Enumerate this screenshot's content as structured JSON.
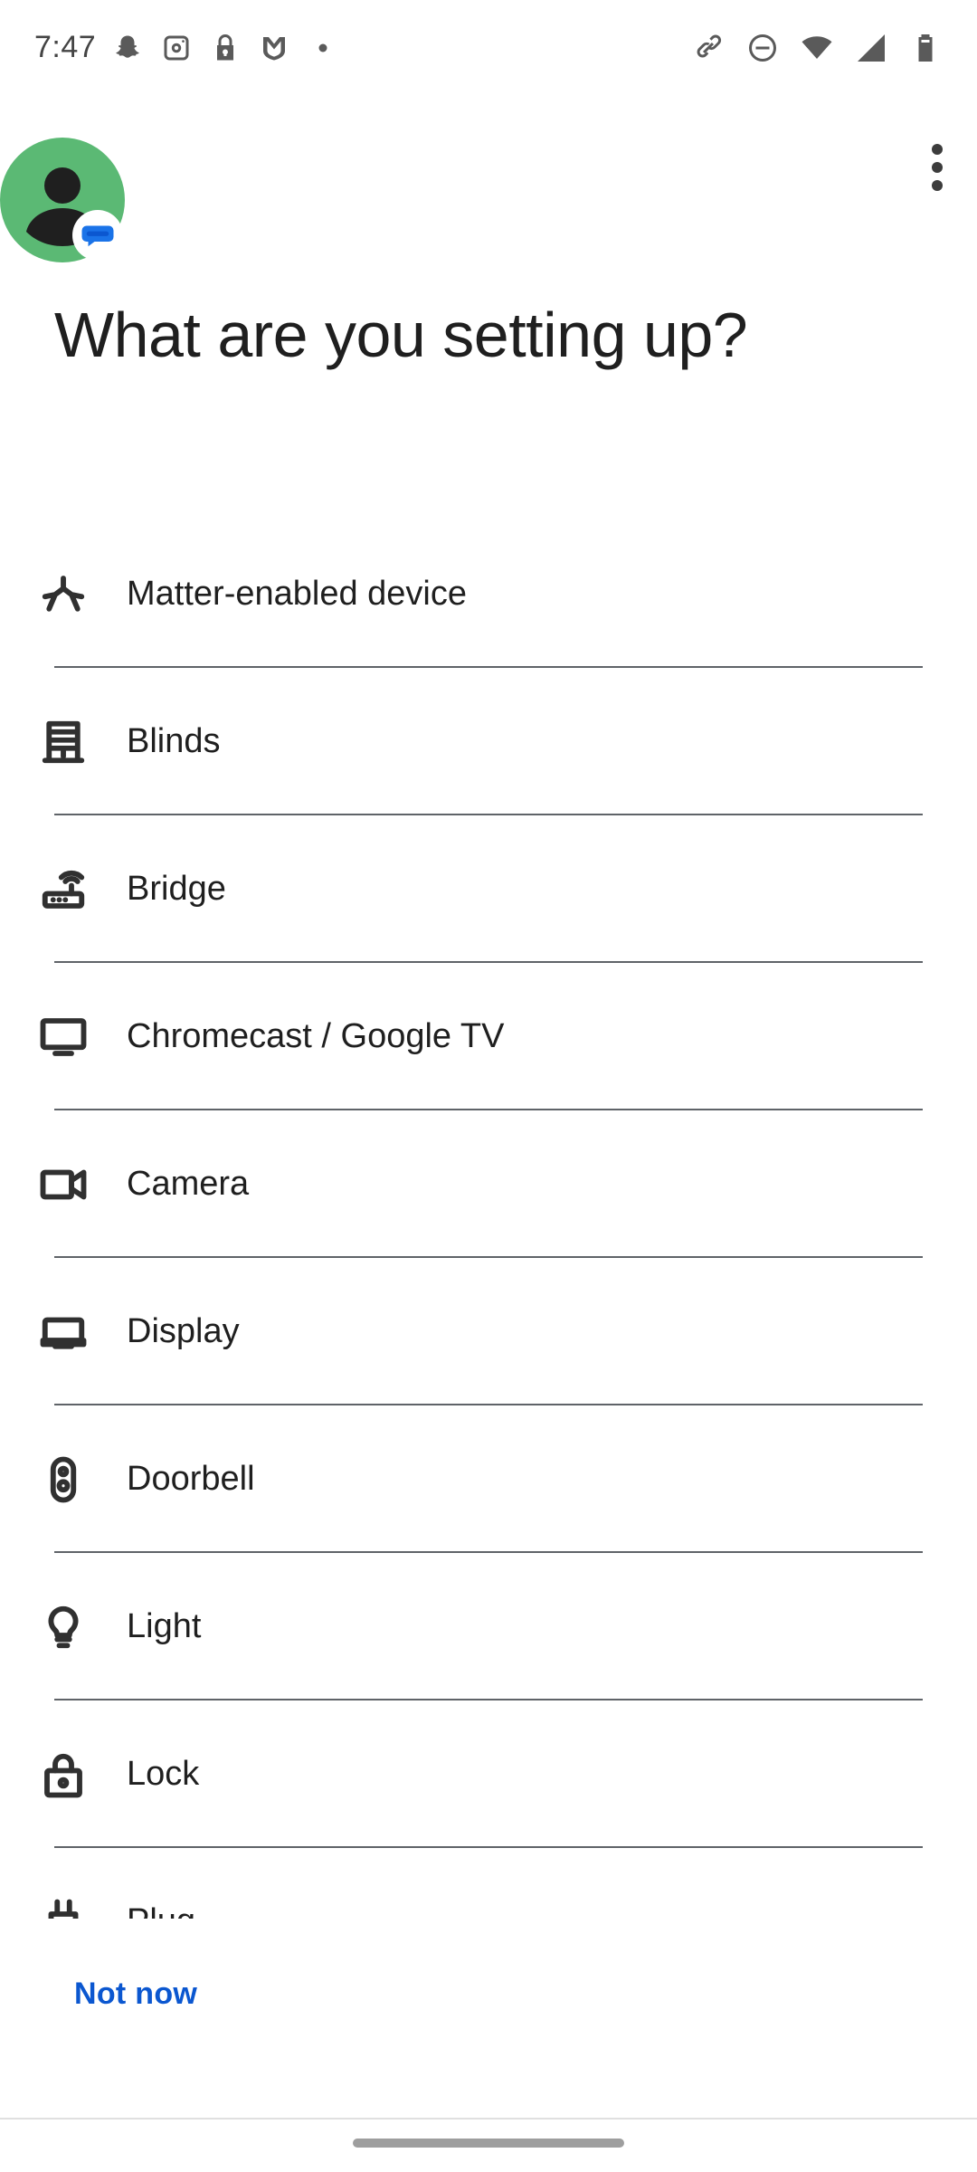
{
  "status_bar": {
    "time": "7:47",
    "left_icons": [
      "snapchat-icon",
      "instagram-icon",
      "lock-notification-icon",
      "shield-app-icon",
      "dot-icon"
    ],
    "right_icons": [
      "link-icon",
      "do-not-disturb-icon",
      "wifi-icon",
      "cell-signal-icon",
      "battery-icon"
    ]
  },
  "header": {
    "avatar": "account-avatar",
    "badge": "messages-badge-icon",
    "menu_icon": "more-vert-icon"
  },
  "page": {
    "title": "What are you setting up?"
  },
  "devices": [
    {
      "label": "Matter-enabled device",
      "icon": "matter-icon"
    },
    {
      "label": "Blinds",
      "icon": "blinds-icon"
    },
    {
      "label": "Bridge",
      "icon": "router-icon"
    },
    {
      "label": "Chromecast / Google TV",
      "icon": "tv-icon"
    },
    {
      "label": "Camera",
      "icon": "videocam-icon"
    },
    {
      "label": "Display",
      "icon": "display-icon"
    },
    {
      "label": "Doorbell",
      "icon": "doorbell-icon"
    },
    {
      "label": "Light",
      "icon": "lightbulb-icon"
    },
    {
      "label": "Lock",
      "icon": "lock-icon"
    },
    {
      "label": "Plug",
      "icon": "plug-icon"
    }
  ],
  "footer": {
    "not_now_label": "Not now"
  },
  "colors": {
    "accent": "#0b57d0",
    "avatar_bg": "#5bb974",
    "divider": "#5f6368",
    "text": "#1f1f1f"
  }
}
